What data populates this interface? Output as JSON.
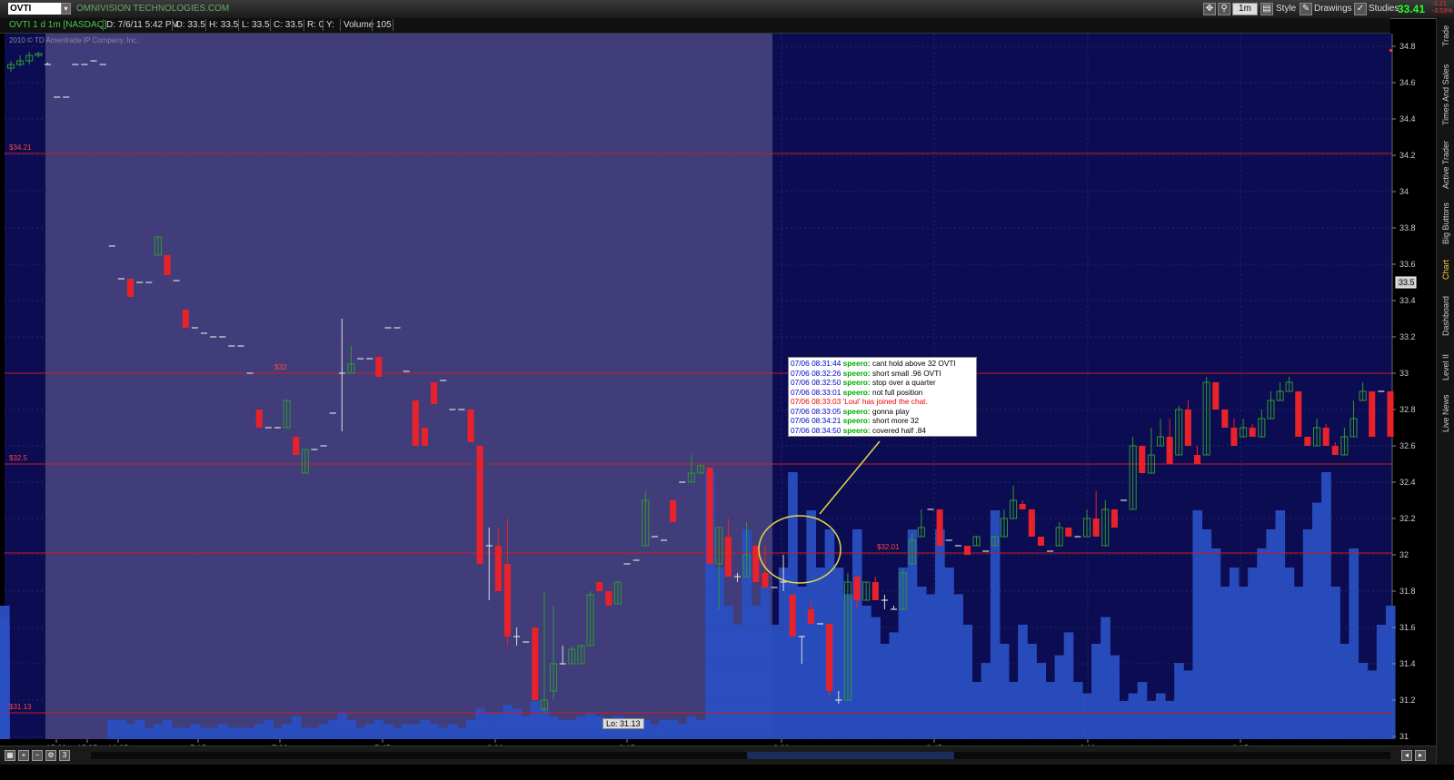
{
  "toolbar": {
    "symbol": "OVTI",
    "company": "OMNIVISION TECHNOLOGIES.COM",
    "interval": "1m",
    "style_label": "Style",
    "drawings_label": "Drawings",
    "studies_label": "Studies",
    "last_price": "33.41",
    "change": "-1.21",
    "change_pct": "-3.53%"
  },
  "infobar": {
    "name": "OVTI 1 d 1m [NASDAQ]",
    "date": "D: 7/6/11 5:42 PM",
    "open": "O: 33.5",
    "high": "H: 33.5",
    "low": "L: 33.5",
    "close": "C: 33.5",
    "r": "R: 0",
    "y": "Y:",
    "volume_label": "Volume",
    "volume": "105"
  },
  "copyright": "2010 © TD Ameritrade IP Company, Inc.",
  "right_tabs": [
    "Trade",
    "Times And Sales",
    "Active Trader",
    "Big Buttons",
    "Chart",
    "Dashboard",
    "Level II",
    "Live News"
  ],
  "active_tab": "Chart",
  "chat": [
    {
      "ts": "07/06 08:31:44",
      "user": "speero:",
      "msg": "cant hold above 32 OVTI"
    },
    {
      "ts": "07/06 08:32:26",
      "user": "speero:",
      "msg": "short small .96 OVTI"
    },
    {
      "ts": "07/06 08:32:50",
      "user": "speero:",
      "msg": "stop over a quarter"
    },
    {
      "ts": "07/06 08:33:01",
      "user": "speero:",
      "msg": "not full position"
    },
    {
      "ts": "07/06 08:33:03",
      "user": "",
      "msg": "'Loui' has joined the chat.",
      "system": true
    },
    {
      "ts": "07/06 08:33:05",
      "user": "speero:",
      "msg": "gonna play"
    },
    {
      "ts": "07/06 08:34:21",
      "user": "speero:",
      "msg": "short more 32"
    },
    {
      "ts": "07/06 08:34:50",
      "user": "speero:",
      "msg": "covered half .84"
    }
  ],
  "low_label": "Lo: 31.13",
  "current_price_tag": "33.5",
  "chart_data": {
    "type": "candlestick",
    "y_range": [
      31.0,
      34.9
    ],
    "y_ticks": [
      "34.8",
      "34.6",
      "34.4",
      "34.2",
      "34",
      "33.8",
      "33.6",
      "33.4",
      "33.2",
      "33",
      "32.8",
      "32.6",
      "32.4",
      "32.2",
      "32",
      "31.8",
      "31.6",
      "31.4",
      "31.2",
      "31"
    ],
    "x_ticks": [
      "15:00",
      "15:25",
      "16:25",
      "7:15",
      "7:33",
      "7:45",
      "8:00",
      "8:15",
      "8:30",
      "8:45",
      "9:00",
      "9:15"
    ],
    "price_lines": [
      {
        "value": 34.21,
        "label": "$34.21"
      },
      {
        "value": 33.0,
        "label": "$33"
      },
      {
        "value": 32.5,
        "label": "$32.5"
      },
      {
        "value": 32.01,
        "label": "$32.01"
      },
      {
        "value": 31.13,
        "label": "$31.13"
      }
    ],
    "colors": {
      "up": "#2e9a2e",
      "down": "#e8222a",
      "flat": "#dddddd",
      "volume": "#2a4fc2",
      "premarket": "#403d7a",
      "regular": "#0c0c52",
      "priceline": "#c81e1e"
    },
    "candles": [
      [
        34.68,
        34.7,
        34.72,
        34.66
      ],
      [
        34.7,
        34.72,
        34.75,
        34.69
      ],
      [
        34.72,
        34.75,
        34.77,
        34.7
      ],
      [
        34.75,
        34.76,
        34.77,
        34.74
      ],
      [
        34.7,
        34.7,
        34.71,
        34.7
      ],
      [
        34.52,
        34.52,
        34.52,
        34.52
      ],
      [
        34.52,
        34.52,
        34.52,
        34.52
      ],
      [
        34.7,
        34.7,
        34.7,
        34.7
      ],
      [
        34.7,
        34.7,
        34.7,
        34.7
      ],
      [
        34.72,
        34.72,
        34.72,
        34.72
      ],
      [
        34.7,
        34.7,
        34.7,
        34.7
      ],
      [
        33.7,
        33.7,
        33.7,
        33.7
      ],
      [
        33.52,
        33.52,
        33.52,
        33.52
      ],
      [
        33.52,
        33.42,
        33.52,
        33.42
      ],
      [
        33.5,
        33.5,
        33.5,
        33.5
      ],
      [
        33.5,
        33.5,
        33.5,
        33.5
      ],
      [
        33.65,
        33.75,
        33.75,
        33.65
      ],
      [
        33.65,
        33.54,
        33.65,
        33.54
      ],
      [
        33.51,
        33.51,
        33.51,
        33.51
      ],
      [
        33.35,
        33.25,
        33.35,
        33.25
      ],
      [
        33.25,
        33.25,
        33.25,
        33.25
      ],
      [
        33.22,
        33.22,
        33.22,
        33.22
      ],
      [
        33.2,
        33.2,
        33.2,
        33.2
      ],
      [
        33.2,
        33.2,
        33.2,
        33.2
      ],
      [
        33.15,
        33.15,
        33.15,
        33.15
      ],
      [
        33.15,
        33.15,
        33.15,
        33.15
      ],
      [
        33.0,
        33.0,
        33.0,
        33.0
      ],
      [
        32.8,
        32.7,
        32.8,
        32.7
      ],
      [
        32.7,
        32.7,
        32.7,
        32.7
      ],
      [
        32.7,
        32.7,
        32.7,
        32.7
      ],
      [
        32.7,
        32.85,
        32.85,
        32.7
      ],
      [
        32.65,
        32.55,
        32.65,
        32.55
      ],
      [
        32.45,
        32.58,
        32.58,
        32.45
      ],
      [
        32.58,
        32.58,
        32.58,
        32.58
      ],
      [
        32.6,
        32.6,
        32.6,
        32.6
      ],
      [
        32.78,
        32.78,
        32.78,
        32.78
      ],
      [
        33.0,
        33.0,
        33.3,
        32.68
      ],
      [
        33.0,
        33.05,
        33.15,
        33.0
      ],
      [
        33.08,
        33.08,
        33.08,
        33.08
      ],
      [
        33.08,
        33.08,
        33.08,
        33.08
      ],
      [
        33.09,
        32.98,
        33.09,
        32.98
      ],
      [
        33.25,
        33.25,
        33.25,
        33.25
      ],
      [
        33.25,
        33.25,
        33.25,
        33.25
      ],
      [
        33.01,
        33.01,
        33.01,
        33.01
      ],
      [
        32.85,
        32.6,
        32.85,
        32.6
      ],
      [
        32.7,
        32.6,
        32.7,
        32.6
      ],
      [
        32.95,
        32.83,
        32.95,
        32.83
      ],
      [
        32.96,
        32.96,
        32.96,
        32.96
      ],
      [
        32.8,
        32.8,
        32.8,
        32.8
      ],
      [
        32.8,
        32.8,
        32.8,
        32.8
      ],
      [
        32.8,
        32.62,
        32.8,
        32.62
      ],
      [
        32.6,
        31.95,
        32.6,
        31.95
      ],
      [
        32.05,
        32.05,
        32.15,
        31.75
      ],
      [
        32.05,
        31.8,
        32.15,
        31.8
      ],
      [
        31.95,
        31.55,
        32.2,
        31.5
      ],
      [
        31.55,
        31.55,
        31.6,
        31.5
      ],
      [
        31.52,
        31.52,
        31.52,
        31.52
      ],
      [
        31.6,
        31.2,
        31.6,
        31.2
      ],
      [
        31.15,
        31.2,
        31.8,
        31.13
      ],
      [
        31.25,
        31.4,
        31.72,
        31.2
      ],
      [
        31.4,
        31.4,
        31.5,
        31.4
      ],
      [
        31.4,
        31.48,
        31.5,
        31.4
      ],
      [
        31.4,
        31.5,
        31.5,
        31.4
      ],
      [
        31.5,
        31.78,
        31.8,
        31.5
      ],
      [
        31.85,
        31.8,
        31.85,
        31.8
      ],
      [
        31.8,
        31.72,
        31.8,
        31.72
      ],
      [
        31.73,
        31.85,
        31.85,
        31.73
      ],
      [
        31.95,
        31.95,
        31.95,
        31.95
      ],
      [
        31.97,
        31.97,
        31.97,
        31.97
      ],
      [
        32.05,
        32.3,
        32.35,
        32.05
      ],
      [
        32.1,
        32.1,
        32.1,
        32.1
      ],
      [
        32.08,
        32.08,
        32.08,
        32.08
      ],
      [
        32.3,
        32.18,
        32.3,
        32.18
      ],
      [
        32.4,
        32.4,
        32.4,
        32.4
      ],
      [
        32.4,
        32.45,
        32.55,
        32.4
      ],
      [
        32.45,
        32.49,
        32.5,
        32.45
      ],
      [
        32.48,
        31.95,
        32.48,
        31.95
      ],
      [
        31.95,
        32.15,
        32.15,
        31.7
      ],
      [
        32.1,
        31.88,
        32.2,
        31.88
      ],
      [
        31.88,
        31.88,
        31.9,
        31.85
      ],
      [
        31.88,
        32.0,
        32.18,
        31.88
      ],
      [
        32.05,
        31.85,
        32.05,
        31.85
      ],
      [
        31.9,
        31.82,
        32.05,
        31.82
      ],
      [
        31.82,
        31.82,
        31.82,
        31.82
      ],
      [
        31.85,
        31.85,
        32.0,
        31.8
      ],
      [
        31.78,
        31.55,
        31.78,
        31.55
      ],
      [
        31.55,
        31.55,
        31.55,
        31.4
      ],
      [
        31.7,
        31.62,
        31.75,
        31.62
      ],
      [
        31.62,
        31.62,
        31.62,
        31.62
      ],
      [
        31.62,
        31.25,
        31.62,
        31.22
      ],
      [
        31.2,
        31.2,
        31.25,
        31.18
      ],
      [
        31.2,
        31.85,
        31.9,
        31.2
      ],
      [
        31.88,
        31.75,
        31.88,
        31.7
      ],
      [
        31.75,
        31.85,
        31.85,
        31.75
      ],
      [
        31.85,
        31.75,
        31.88,
        31.75
      ],
      [
        31.75,
        31.75,
        31.78,
        31.7
      ],
      [
        31.7,
        31.7,
        31.72,
        31.7
      ],
      [
        31.7,
        31.9,
        31.92,
        31.7
      ],
      [
        31.95,
        32.08,
        32.12,
        31.95
      ],
      [
        32.1,
        32.15,
        32.25,
        32.1
      ],
      [
        32.25,
        32.25,
        32.25,
        32.25
      ],
      [
        32.25,
        32.05,
        32.25,
        32.05
      ],
      [
        32.08,
        32.08,
        32.08,
        32.08
      ],
      [
        32.05,
        32.05,
        32.05,
        32.05
      ],
      [
        32.05,
        32.0,
        32.05,
        32.0
      ],
      [
        32.05,
        32.1,
        32.1,
        32.05
      ],
      [
        32.02,
        32.02,
        32.02,
        32.02
      ],
      [
        32.05,
        32.1,
        32.1,
        32.05
      ],
      [
        32.1,
        32.2,
        32.25,
        32.1
      ],
      [
        32.2,
        32.3,
        32.38,
        32.2
      ],
      [
        32.28,
        32.25,
        32.3,
        32.25
      ],
      [
        32.25,
        32.1,
        32.25,
        32.1
      ],
      [
        32.1,
        32.05,
        32.1,
        32.05
      ],
      [
        32.02,
        32.02,
        32.02,
        32.02
      ],
      [
        32.05,
        32.15,
        32.18,
        32.05
      ],
      [
        32.15,
        32.1,
        32.15,
        32.1
      ],
      [
        32.1,
        32.1,
        32.1,
        32.1
      ],
      [
        32.1,
        32.2,
        32.25,
        32.1
      ],
      [
        32.2,
        32.1,
        32.35,
        32.1
      ],
      [
        32.05,
        32.25,
        32.3,
        32.05
      ],
      [
        32.25,
        32.15,
        32.25,
        32.15
      ],
      [
        32.3,
        32.3,
        32.3,
        32.3
      ],
      [
        32.25,
        32.6,
        32.65,
        32.25
      ],
      [
        32.6,
        32.45,
        32.6,
        32.45
      ],
      [
        32.45,
        32.55,
        32.7,
        32.45
      ],
      [
        32.6,
        32.65,
        32.75,
        32.6
      ],
      [
        32.65,
        32.5,
        32.75,
        32.5
      ],
      [
        32.55,
        32.8,
        32.82,
        32.55
      ],
      [
        32.8,
        32.6,
        32.85,
        32.6
      ],
      [
        32.55,
        32.5,
        32.6,
        32.5
      ],
      [
        32.55,
        32.95,
        32.98,
        32.55
      ],
      [
        32.95,
        32.8,
        32.95,
        32.8
      ],
      [
        32.8,
        32.7,
        32.8,
        32.7
      ],
      [
        32.7,
        32.6,
        32.75,
        32.6
      ],
      [
        32.65,
        32.7,
        32.75,
        32.65
      ],
      [
        32.7,
        32.65,
        32.72,
        32.65
      ],
      [
        32.65,
        32.75,
        32.8,
        32.65
      ],
      [
        32.75,
        32.85,
        32.9,
        32.75
      ],
      [
        32.85,
        32.9,
        32.95,
        32.85
      ],
      [
        32.9,
        32.95,
        32.98,
        32.9
      ],
      [
        32.9,
        32.65,
        32.9,
        32.65
      ],
      [
        32.65,
        32.6,
        32.65,
        32.6
      ],
      [
        32.6,
        32.7,
        32.75,
        32.6
      ],
      [
        32.7,
        32.6,
        32.72,
        32.6
      ],
      [
        32.6,
        32.55,
        32.62,
        32.55
      ],
      [
        32.55,
        32.65,
        32.7,
        32.55
      ],
      [
        32.65,
        32.75,
        32.85,
        32.65
      ],
      [
        32.85,
        32.9,
        32.95,
        32.85
      ],
      [
        32.9,
        32.65,
        32.9,
        32.65
      ],
      [
        32.9,
        32.9,
        32.9,
        32.9
      ],
      [
        32.9,
        32.65,
        32.9,
        32.65
      ]
    ],
    "volume": [
      0.0,
      0.0,
      0.0,
      0.0,
      0.0,
      0.0,
      0.0,
      0.0,
      0.0,
      0.0,
      0.0,
      0.05,
      0.05,
      0.04,
      0.05,
      0.03,
      0.04,
      0.05,
      0.03,
      0.03,
      0.04,
      0.03,
      0.03,
      0.04,
      0.03,
      0.03,
      0.03,
      0.04,
      0.05,
      0.03,
      0.04,
      0.06,
      0.03,
      0.03,
      0.04,
      0.05,
      0.07,
      0.05,
      0.03,
      0.04,
      0.05,
      0.04,
      0.03,
      0.04,
      0.04,
      0.05,
      0.04,
      0.03,
      0.04,
      0.03,
      0.05,
      0.08,
      0.07,
      0.07,
      0.09,
      0.08,
      0.06,
      0.1,
      0.08,
      0.06,
      0.05,
      0.05,
      0.06,
      0.07,
      0.06,
      0.05,
      0.06,
      0.05,
      0.04,
      0.05,
      0.04,
      0.05,
      0.05,
      0.04,
      0.06,
      0.05,
      0.7,
      0.45,
      0.35,
      0.3,
      0.55,
      0.35,
      0.4,
      0.3,
      0.45,
      0.7,
      0.4,
      0.6,
      0.45,
      0.55,
      0.45,
      0.38,
      0.55,
      0.35,
      0.32,
      0.25,
      0.28,
      0.45,
      0.55,
      0.4,
      0.38,
      0.55,
      0.45,
      0.38,
      0.3,
      0.15,
      0.2,
      0.6,
      0.25,
      0.15,
      0.3,
      0.25,
      0.2,
      0.15,
      0.22,
      0.28,
      0.15,
      0.12,
      0.25,
      0.32,
      0.22,
      0.1,
      0.12,
      0.15,
      0.1,
      0.12,
      0.1,
      0.2,
      0.18,
      0.6,
      0.55,
      0.5,
      0.4,
      0.45,
      0.4,
      0.45,
      0.5,
      0.55,
      0.6,
      0.45,
      0.4,
      0.55,
      0.62,
      0.7,
      0.4,
      0.25,
      0.5,
      0.2,
      0.18,
      0.3,
      0.35,
      0.28,
      0.32,
      0.2,
      0.22,
      0.3,
      0.26,
      0.35,
      0.2
    ]
  }
}
